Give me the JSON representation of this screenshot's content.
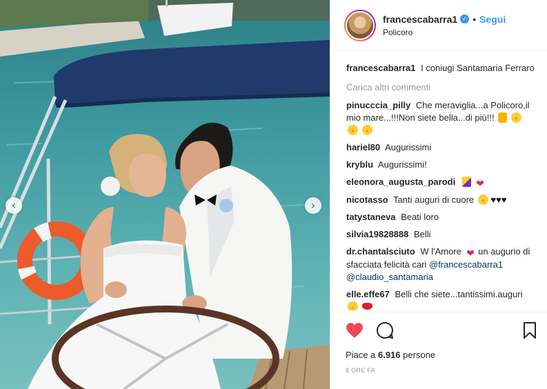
{
  "post": {
    "username": "francescabarra1",
    "follow_label": "Segui",
    "location": "Policoro",
    "caption_user": "francescabarra1",
    "caption_text": "I coniugi Santamaria Ferraro",
    "load_more": "Carica altri commenti",
    "likes_prefix": "Piace a",
    "likes_count": "6.916",
    "likes_suffix": "persone",
    "time": "8 ORE FA"
  },
  "comments": [
    {
      "user": "pinucccia_pilly",
      "text": "Che meraviglia...a Policoro,il mio mare...!!!Non siete bella...di più!!!"
    },
    {
      "user": "hariel80",
      "text": "Augurissimi"
    },
    {
      "user": "kryblu",
      "text": "Augurissimi!"
    },
    {
      "user": "eleonora_augusta_parodi",
      "text": ""
    },
    {
      "user": "nicotasso",
      "text": "Tanti auguri di cuore"
    },
    {
      "user": "tatystaneva",
      "text": "Beati loro"
    },
    {
      "user": "silvia19828888",
      "text": "Belli"
    },
    {
      "user": "dr.chantalsciuto",
      "text": "W l'Amore",
      "text2": "un augurio di sfacciata felicità cari",
      "mention1": "@francescabarra1",
      "mention2": "@claudio_santamaria"
    },
    {
      "user": "elle.effe67",
      "text": "Belli che siete...tantissimi.auguri"
    }
  ],
  "icons": {
    "like": "heart-icon",
    "comment": "comment-bubble-icon",
    "save": "bookmark-icon",
    "verified": "verified-badge-icon",
    "prev": "chevron-left-icon",
    "next": "chevron-right-icon"
  },
  "colors": {
    "accent": "#3897f0",
    "like": "#ed4956",
    "mention": "#003569",
    "muted": "#999999"
  }
}
